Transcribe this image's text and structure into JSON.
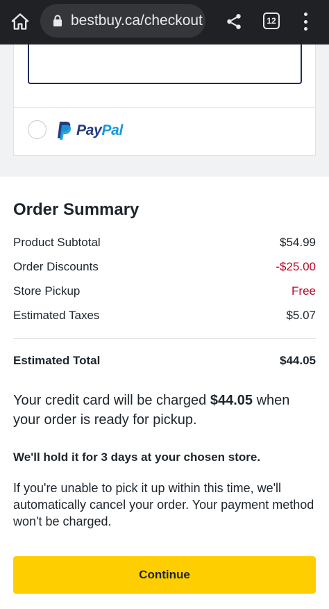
{
  "browser": {
    "url": "bestbuy.ca/checkout",
    "tab_count": "12",
    "icons": {
      "home": "home-icon",
      "lock": "lock-icon",
      "share": "share-icon",
      "menu": "more-vert-icon"
    }
  },
  "payment": {
    "paypal_brand_pay": "Pay",
    "paypal_brand_pal": "Pal"
  },
  "summary": {
    "title": "Order Summary",
    "rows": [
      {
        "label": "Product Subtotal",
        "value": "$54.99"
      },
      {
        "label": "Order Discounts",
        "value": "-$25.00"
      },
      {
        "label": "Store Pickup",
        "value": "Free"
      },
      {
        "label": "Estimated Taxes",
        "value": "$5.07"
      }
    ],
    "total_label": "Estimated Total",
    "total_value": "$44.05"
  },
  "notice": {
    "charge_prefix": "Your credit card will be charged ",
    "charge_amount": "$44.05",
    "charge_suffix": " when your order is ready for pickup.",
    "hold": "We'll hold it for 3 days at your chosen store.",
    "cancel": "If you're unable to pick it up within this time, we'll automatically cancel your order. Your payment method won't be charged."
  },
  "actions": {
    "continue_label": "Continue"
  },
  "colors": {
    "accent_yellow": "#ffce00",
    "discount_red": "#bb0628",
    "chrome_dark": "#202124"
  }
}
